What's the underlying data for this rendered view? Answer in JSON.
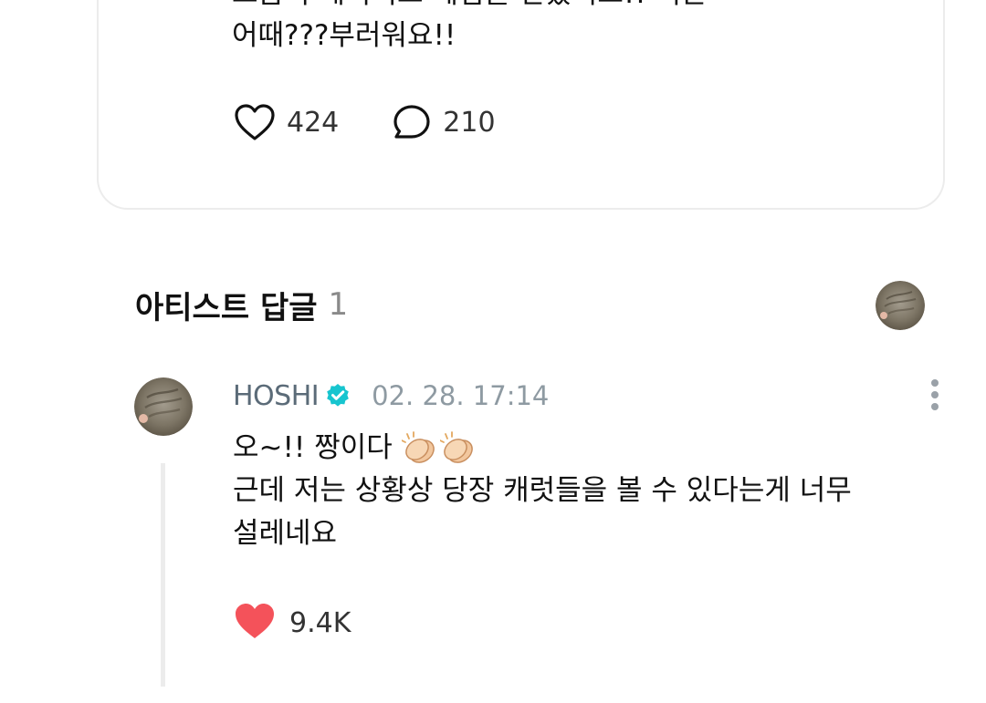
{
  "post": {
    "text_lines": [
      "스쿱이 데이비드 베컴을 만났어요!! 너는",
      "어때???부러워요!!"
    ],
    "like_count": "424",
    "comment_count": "210",
    "icons": {
      "like": "heart-outline-icon",
      "comment": "speech-bubble-icon"
    }
  },
  "artist_replies": {
    "title": "아티스트 답글",
    "count": "1"
  },
  "reply": {
    "author": "HOSHI",
    "timestamp": "02. 28. 17:14",
    "line1": "오~!! 짱이다",
    "line2": "근데 저는 상황상 당장 캐럿들을 볼 수 있다는게 너무",
    "line3": "설레네요",
    "like_count": "9.4K",
    "icons": {
      "verified": "verified-badge-icon",
      "emoji": "clapping-hands-emoji",
      "like": "heart-filled-icon",
      "menu": "more-vertical-icon"
    }
  },
  "colors": {
    "verified": "#17c5cf",
    "heart_filled": "#f4525a",
    "author": "#5b6b78",
    "timestamp": "#8e9aa2"
  }
}
